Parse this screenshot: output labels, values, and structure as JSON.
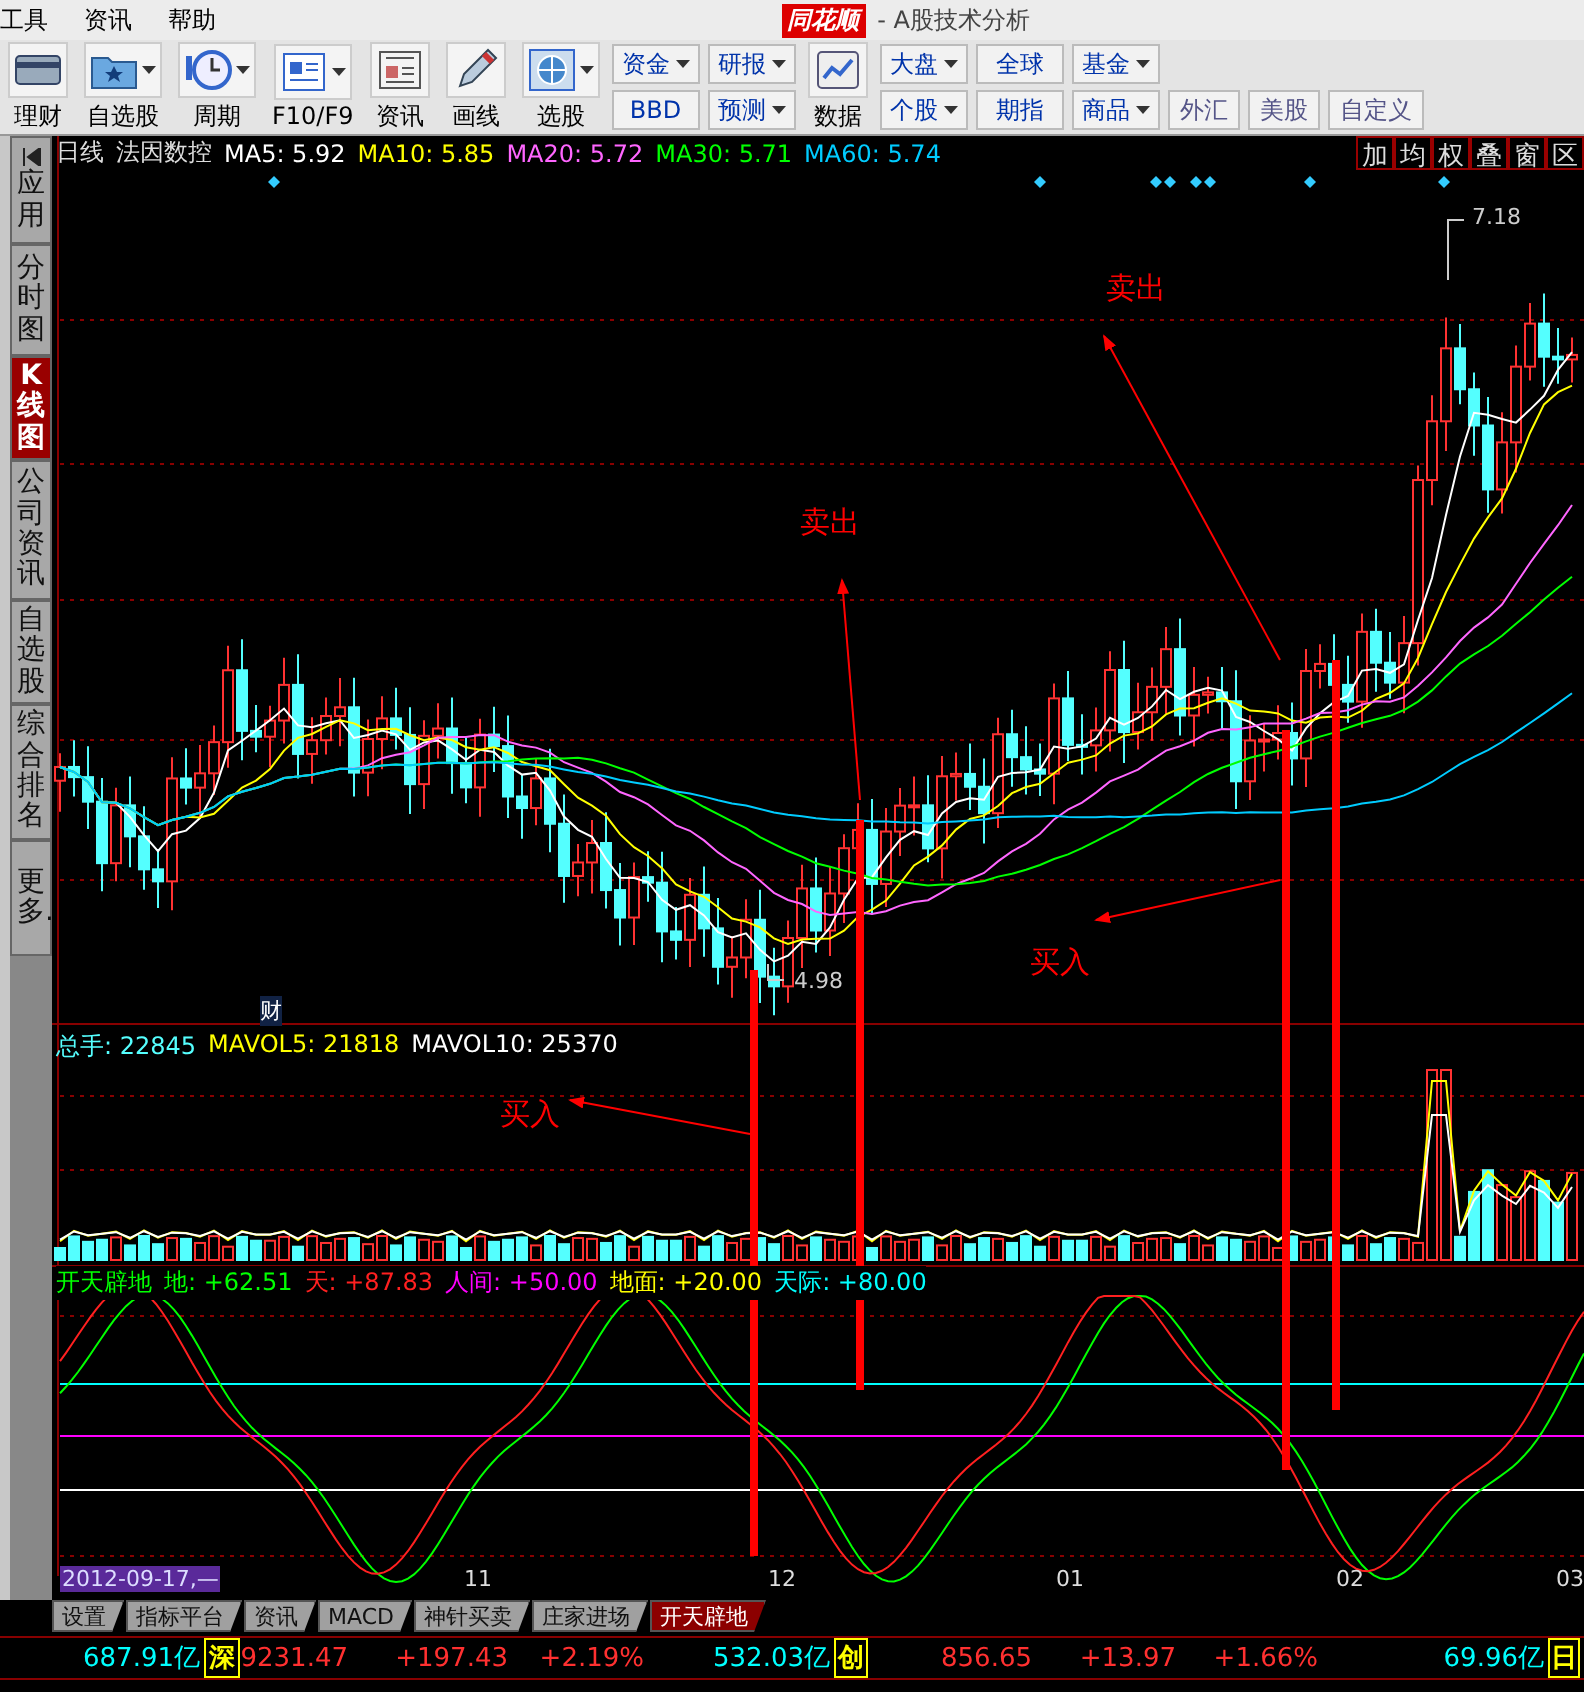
{
  "menu": [
    "工具",
    "资讯",
    "帮助"
  ],
  "title": {
    "logo": "同花顺",
    "text": "- A股技术分析"
  },
  "toolbar": [
    {
      "kind": "big",
      "label": "理财",
      "dropdown": false
    },
    {
      "kind": "big",
      "label": "自选股",
      "dropdown": true
    },
    {
      "kind": "big",
      "label": "周期",
      "dropdown": true
    },
    {
      "kind": "big",
      "label": "F10/F9",
      "dropdown": true
    },
    {
      "kind": "big",
      "label": "资讯",
      "dropdown": false
    },
    {
      "kind": "big",
      "label": "画线",
      "dropdown": false
    },
    {
      "kind": "big",
      "label": "选股",
      "dropdown": true
    },
    {
      "kind": "pair",
      "buttons": [
        {
          "label": "资金",
          "dropdown": true
        },
        {
          "label": "BBD",
          "dropdown": false
        }
      ]
    },
    {
      "kind": "pair",
      "buttons": [
        {
          "label": "研报",
          "dropdown": true
        },
        {
          "label": "预测",
          "dropdown": true
        }
      ]
    },
    {
      "kind": "big",
      "label": "数据",
      "dropdown": false
    },
    {
      "kind": "pair",
      "buttons": [
        {
          "label": "大盘",
          "dropdown": true
        },
        {
          "label": "个股",
          "dropdown": true
        }
      ]
    },
    {
      "kind": "pair",
      "buttons": [
        {
          "label": "全球",
          "dropdown": false
        },
        {
          "label": "期指",
          "dropdown": false
        }
      ]
    },
    {
      "kind": "pair",
      "buttons": [
        {
          "label": "基金",
          "dropdown": true
        },
        {
          "label": "商品",
          "dropdown": true
        }
      ]
    },
    {
      "kind": "flat",
      "label": "外汇",
      "dropdown": false
    },
    {
      "kind": "flat",
      "label": "美股",
      "dropdown": false
    },
    {
      "kind": "flat",
      "label": "自定义",
      "dropdown": false
    }
  ],
  "sidebar": [
    {
      "label": "应用",
      "selected": false
    },
    {
      "label": "分时图",
      "selected": false
    },
    {
      "label": "K线图",
      "selected": true
    },
    {
      "label": "公司资讯",
      "selected": false
    },
    {
      "label": "自选股",
      "selected": false
    },
    {
      "label": "综合排名",
      "selected": false
    },
    {
      "label": "更多..",
      "selected": false
    }
  ],
  "chart": {
    "period": "日线",
    "stock": "法因数控",
    "ma": [
      {
        "text": "MA5: 5.92",
        "color": "#ffffff"
      },
      {
        "text": "MA10: 5.85",
        "color": "#ffff00"
      },
      {
        "text": "MA20: 5.72",
        "color": "#ff66ff"
      },
      {
        "text": "MA30: 5.71",
        "color": "#00ff00"
      },
      {
        "text": "MA60: 5.74",
        "color": "#00ccff"
      }
    ],
    "tools": [
      "加",
      "均",
      "权",
      "叠",
      "窗",
      "区"
    ],
    "high_label": "7.18",
    "low_label": "4.98",
    "marker": "财"
  },
  "volume": [
    {
      "text": "总手: 22845",
      "color": "#55ffff"
    },
    {
      "text": "MAVOL5: 21818",
      "color": "#ffff00"
    },
    {
      "text": "MAVOL10: 25370",
      "color": "#ffffff"
    }
  ],
  "indicator": [
    {
      "text": "开天辟地",
      "color": "#00ff00"
    },
    {
      "text": "地: +62.51",
      "color": "#00ff00"
    },
    {
      "text": "天: +87.83",
      "color": "#ff2020"
    },
    {
      "text": "人间: +50.00",
      "color": "#ff00ff"
    },
    {
      "text": "地面: +20.00",
      "color": "#ffff00"
    },
    {
      "text": "天际: +80.00",
      "color": "#00ffff"
    }
  ],
  "x_axis": {
    "date": "2012-09-17,—",
    "labels": [
      "11",
      "12",
      "01",
      "02",
      "03"
    ]
  },
  "annotations": [
    {
      "text": "卖出"
    },
    {
      "text": "卖出"
    },
    {
      "text": "买入"
    },
    {
      "text": "买入"
    }
  ],
  "bottom_tabs": [
    {
      "label": "设置",
      "selected": false
    },
    {
      "label": "指标平台",
      "selected": false
    },
    {
      "label": "资讯",
      "selected": false
    },
    {
      "label": "MACD",
      "selected": false
    },
    {
      "label": "神针买卖",
      "selected": false
    },
    {
      "label": "庄家进场",
      "selected": false
    },
    {
      "label": "开天辟地",
      "selected": true
    }
  ],
  "status": [
    {
      "kind": "value",
      "text": "687.91亿",
      "color": "#00ffff"
    },
    {
      "kind": "label",
      "text": "深",
      "color": "#ffff00"
    },
    {
      "kind": "value",
      "text": "9231.47",
      "color": "#ff3030"
    },
    {
      "kind": "value",
      "text": "+197.43",
      "color": "#ff3030"
    },
    {
      "kind": "value",
      "text": "+2.19%",
      "color": "#ff3030"
    },
    {
      "kind": "value",
      "text": "532.03亿",
      "color": "#00ffff"
    },
    {
      "kind": "label",
      "text": "创",
      "color": "#ffff00"
    },
    {
      "kind": "value",
      "text": "856.65",
      "color": "#ff3030"
    },
    {
      "kind": "value",
      "text": "+13.97",
      "color": "#ff3030"
    },
    {
      "kind": "value",
      "text": "+1.66%",
      "color": "#ff3030"
    },
    {
      "kind": "value",
      "text": "69.96亿",
      "color": "#00ffff"
    },
    {
      "kind": "label",
      "text": "日",
      "color": "#ffff00"
    }
  ]
}
